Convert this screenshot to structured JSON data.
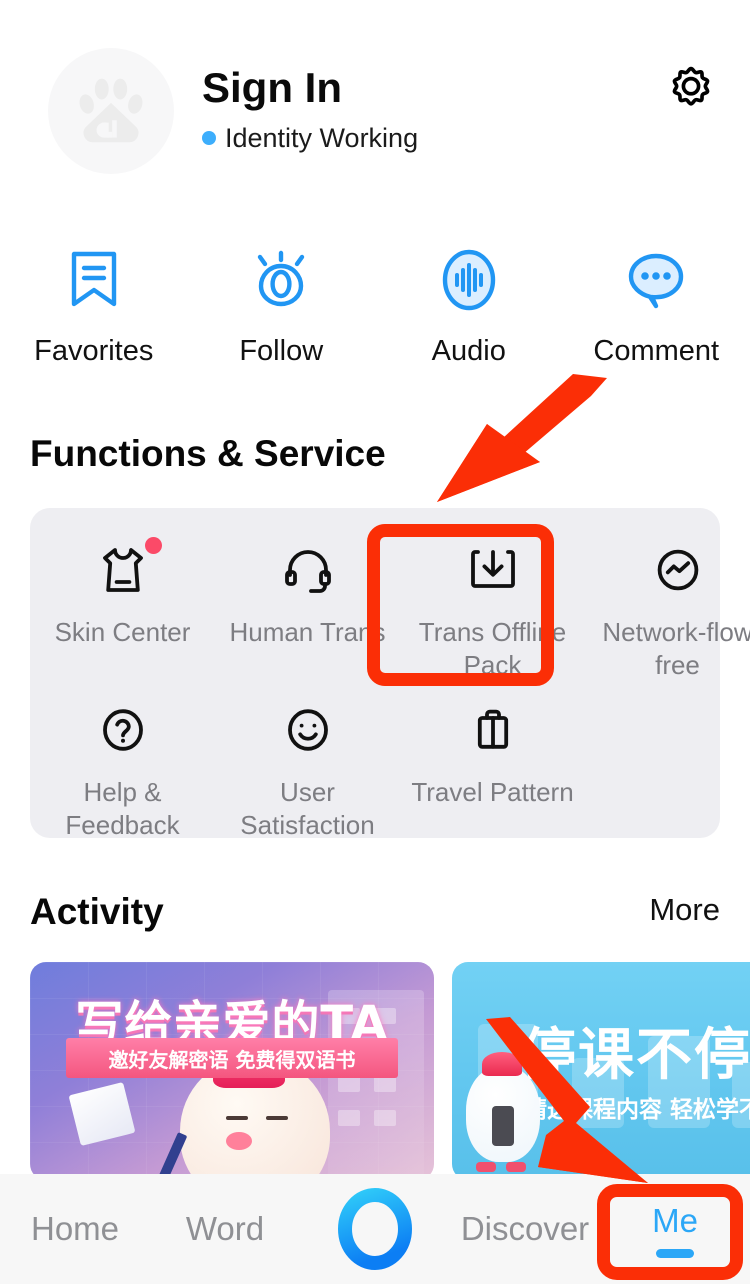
{
  "header": {
    "avatar_icon": "baidu-paw-logo",
    "title": "Sign In",
    "status_label": "Identity Working",
    "status_dot_color": "#3daefc",
    "settings_icon": "gear-icon"
  },
  "quick_actions": [
    {
      "label": "Favorites",
      "icon": "bookmark-icon",
      "color": "#2196f3"
    },
    {
      "label": "Follow",
      "icon": "eye-icon",
      "color": "#2196f3"
    },
    {
      "label": "Audio",
      "icon": "audio-wave-icon",
      "color": "#2196f3"
    },
    {
      "label": "Comment",
      "icon": "comment-bubble-icon",
      "color": "#2196f3"
    }
  ],
  "functions": {
    "title": "Functions & Service",
    "items": [
      {
        "label": "Skin Center",
        "icon": "tshirt-icon",
        "badge": true
      },
      {
        "label": "Human Trans",
        "icon": "headset-icon",
        "badge": false
      },
      {
        "label": "Trans Offline Pack",
        "icon": "download-box-icon",
        "badge": false
      },
      {
        "label": "Network-flow free",
        "icon": "signal-circle-icon",
        "badge": false
      },
      {
        "label": "Help & Feedback",
        "icon": "question-mark-icon",
        "badge": false
      },
      {
        "label": "User Satisfaction",
        "icon": "smiley-face-icon",
        "badge": false
      },
      {
        "label": "Travel Pattern",
        "icon": "suitcase-icon",
        "badge": false
      }
    ]
  },
  "activity": {
    "title": "Activity",
    "more_label": "More",
    "banners": [
      {
        "name": "write-to-dear-ta",
        "title": "写给亲爱的TA",
        "subtitle": "邀好友解密语 免费得双语书"
      },
      {
        "name": "class-suspended-learning-continues",
        "title": "停课不停学",
        "subtitle": "精选课程内容 轻松学不停"
      }
    ]
  },
  "tabbar": {
    "items": [
      {
        "label": "Home",
        "active": false
      },
      {
        "label": "Word",
        "active": false
      },
      {
        "label": "",
        "active": false,
        "icon": "voice-ring-icon"
      },
      {
        "label": "Discover",
        "active": false
      },
      {
        "label": "Me",
        "active": true
      }
    ],
    "active_color": "#2ba7f7",
    "inactive_color": "#8f9094"
  },
  "annotations": {
    "highlight_color": "#fb2e06",
    "boxes": [
      {
        "target": "Trans Offline Pack"
      },
      {
        "target": "Me"
      }
    ],
    "arrows": [
      {
        "points_to": "Trans Offline Pack"
      },
      {
        "points_to": "Me"
      }
    ]
  }
}
